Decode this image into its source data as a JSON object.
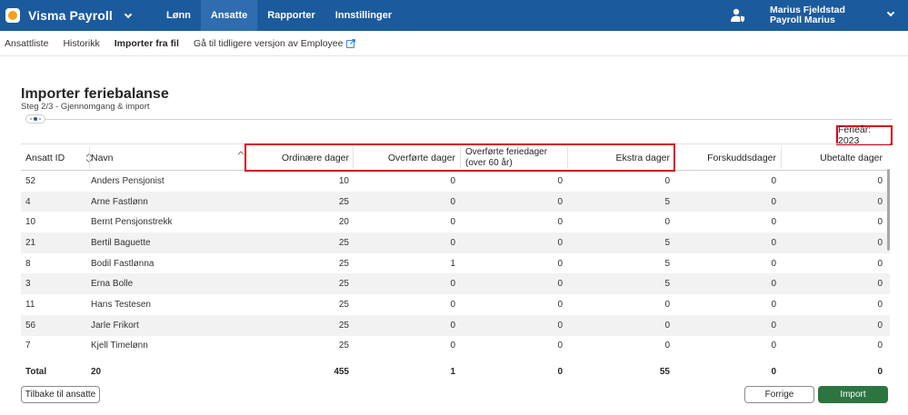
{
  "app": {
    "name": "Visma Payroll",
    "logo_color": "#f6a01a",
    "brand_color": "#1b5a9d"
  },
  "topnav": {
    "items": [
      {
        "label": "Lønn",
        "active": false
      },
      {
        "label": "Ansatte",
        "active": true
      },
      {
        "label": "Rapporter",
        "active": false
      },
      {
        "label": "Innstillinger",
        "active": false
      }
    ]
  },
  "user": {
    "name": "Marius Fjeldstad",
    "company": "Payroll Marius",
    "icon": "user-shield-icon"
  },
  "subnav": {
    "items": [
      {
        "label": "Ansattliste",
        "active": false
      },
      {
        "label": "Historikk",
        "active": false
      },
      {
        "label": "Importer fra fil",
        "active": true
      },
      {
        "label": "Gå til tidligere versjon av Employee",
        "active": false,
        "icon": "external-link-icon"
      }
    ]
  },
  "page": {
    "title": "Importer feriebalanse",
    "step": "Steg 2/3 - Gjennomgang & import",
    "holiday_year": "Ferieår: 2023"
  },
  "table": {
    "columns": [
      {
        "label": "Ansatt ID",
        "sortable": true
      },
      {
        "label": "Navn",
        "sortable": true
      },
      {
        "label": "Ordinære dager"
      },
      {
        "label": "Overførte dager"
      },
      {
        "label": "Overførte feriedager (over 60 år)"
      },
      {
        "label": "Ekstra dager"
      },
      {
        "label": "Forskuddsdager"
      },
      {
        "label": "Ubetalte dager"
      }
    ],
    "rows": [
      [
        "52",
        "Anders Pensjonist",
        "10",
        "0",
        "0",
        "0",
        "0",
        "0"
      ],
      [
        "4",
        "Arne Fastlønn",
        "25",
        "0",
        "0",
        "5",
        "0",
        "0"
      ],
      [
        "10",
        "Bernt Pensjonstrekk",
        "20",
        "0",
        "0",
        "0",
        "0",
        "0"
      ],
      [
        "21",
        "Bertil Baguette",
        "25",
        "0",
        "0",
        "5",
        "0",
        "0"
      ],
      [
        "8",
        "Bodil Fastlønna",
        "25",
        "1",
        "0",
        "5",
        "0",
        "0"
      ],
      [
        "3",
        "Erna Bolle",
        "25",
        "0",
        "0",
        "5",
        "0",
        "0"
      ],
      [
        "11",
        "Hans Testesen",
        "25",
        "0",
        "0",
        "0",
        "0",
        "0"
      ],
      [
        "56",
        "Jarle Frikort",
        "25",
        "0",
        "0",
        "0",
        "0",
        "0"
      ],
      [
        "7",
        "Kjell Timelønn",
        "25",
        "0",
        "0",
        "0",
        "0",
        "0"
      ]
    ],
    "total": [
      "Total",
      "20",
      "455",
      "1",
      "0",
      "55",
      "0",
      "0"
    ]
  },
  "buttons": {
    "back": "Tilbake til ansatte",
    "previous": "Forrige",
    "import": "Import"
  },
  "colors": {
    "highlight": "#d6001c",
    "import_button": "#2c7541"
  }
}
